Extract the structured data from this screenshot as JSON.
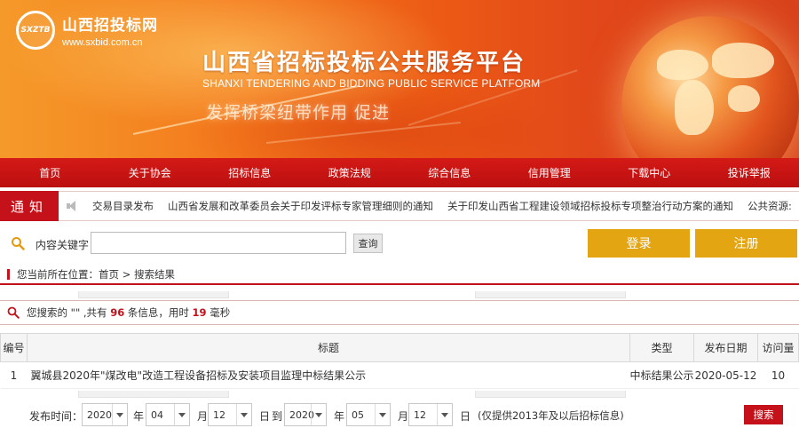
{
  "header": {
    "logo_abbr": "SXZTB",
    "site_name": "山西招投标网",
    "site_url": "www.sxbid.com.cn",
    "platform_title": "山西省招标投标公共服务平台",
    "platform_subtitle": "SHANXI TENDERING AND BIDDING PUBLIC SERVICE PLATFORM",
    "slogan": "发挥桥梁纽带作用 促进"
  },
  "nav": {
    "items": [
      "首页",
      "关于协会",
      "招标信息",
      "政策法规",
      "综合信息",
      "信用管理",
      "下载中心",
      "投诉举报"
    ]
  },
  "notice": {
    "label": "通知",
    "items": [
      "交易目录发布",
      "山西省发展和改革委员会关于印发评标专家管理细则的通知",
      "关于印发山西省工程建设领域招标投标专项整治行动方案的通知",
      "公共资源:"
    ]
  },
  "search": {
    "label": "内容关键字",
    "value": "",
    "query_button": "查询",
    "login_button": "登录",
    "register_button": "注册"
  },
  "breadcrumb": {
    "prefix": "您当前所在位置：",
    "home": "首页",
    "separator": " > ",
    "current": "搜索结果"
  },
  "summary": {
    "prefix": "您搜索的 \"\" ,共有 ",
    "count": "96",
    "middle": " 条信息，用时 ",
    "time": "19",
    "suffix": " 毫秒"
  },
  "table": {
    "headers": [
      "编号",
      "标题",
      "类型",
      "发布日期",
      "访问量"
    ],
    "rows": [
      {
        "no": "1",
        "title": "翼城县2020年\"煤改电\"改造工程设备招标及安装项目监理中标结果公示",
        "type": "中标结果公示",
        "date": "2020-05-12",
        "views": "10"
      }
    ]
  },
  "filter": {
    "label": "发布时间：",
    "from_year": "2020",
    "year_unit": "年",
    "from_month": "04",
    "month_unit": "月",
    "from_day": "12",
    "day_unit": "日",
    "to": "到",
    "to_year": "2020",
    "to_month": "05",
    "to_day": "12",
    "note": "(仅提供2013年及以后招标信息)",
    "search_button": "搜索"
  },
  "colors": {
    "brand_red": "#c4111a",
    "accent_gold": "#e3a612",
    "banner_orange": "#f4781c"
  }
}
